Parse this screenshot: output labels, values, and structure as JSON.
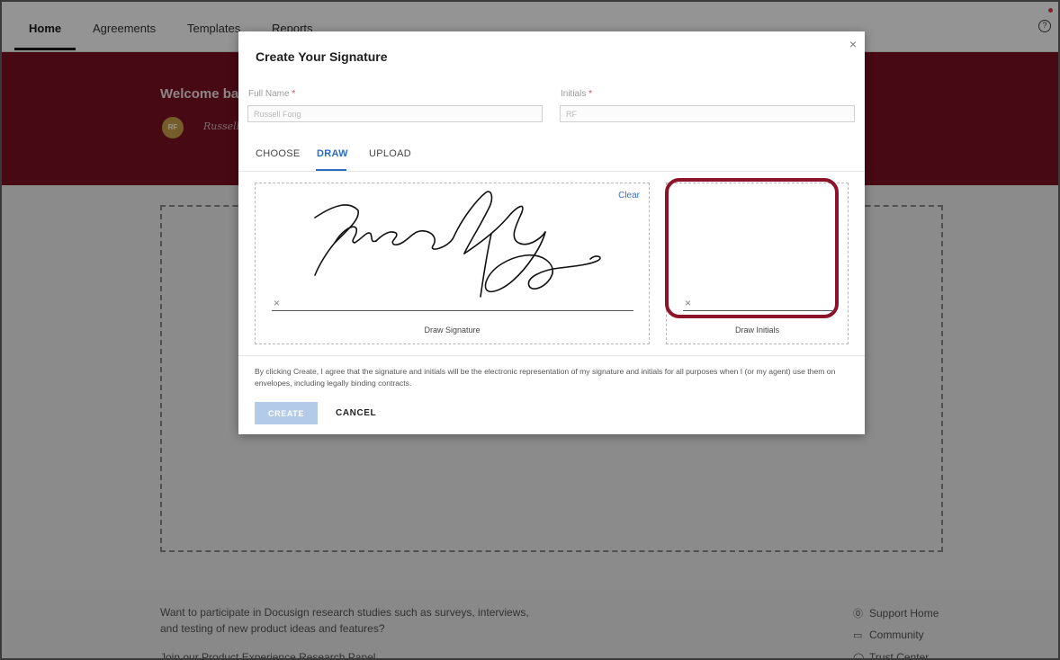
{
  "nav": {
    "tabs": [
      "Home",
      "Agreements",
      "Templates",
      "Reports"
    ],
    "help_icon": "help-circle-icon"
  },
  "hero": {
    "welcome": "Welcome ba",
    "avatar_initials": "RF",
    "mini_signature": "Russell"
  },
  "footer": {
    "line1": "Want to participate in Docusign research studies such as surveys, interviews,",
    "line2": "and testing of new product ideas and features?",
    "line3": "Join our Product Experience Research Panel",
    "links": [
      {
        "label": "Support Home",
        "icon": "help-circle-icon"
      },
      {
        "label": "Community",
        "icon": "chat-icon"
      },
      {
        "label": "Trust Center",
        "icon": "shield-icon"
      }
    ]
  },
  "modal": {
    "title": "Create Your Signature",
    "close": "×",
    "full_name_label": "Full Name",
    "full_name_value": "Russell Fong",
    "initials_label": "Initials",
    "initials_value": "RF",
    "required_mark": "*",
    "tabs": [
      "CHOOSE",
      "DRAW",
      "UPLOAD"
    ],
    "active_tab": "DRAW",
    "clear": "Clear",
    "x_mark": "×",
    "draw_signature_caption": "Draw Signature",
    "draw_initials_caption": "Draw Initials",
    "legal_text": "By clicking Create, I agree that the signature and initials will be the electronic representation of my signature and initials for all purposes when I (or my agent) use them on envelopes, including legally binding contracts.",
    "create_button": "CREATE",
    "cancel_button": "CANCEL"
  },
  "colors": {
    "brand": "#7a1024",
    "accent_blue": "#2a6cc2",
    "highlight": "#8c1328",
    "create_disabled": "#b3cbe8"
  }
}
